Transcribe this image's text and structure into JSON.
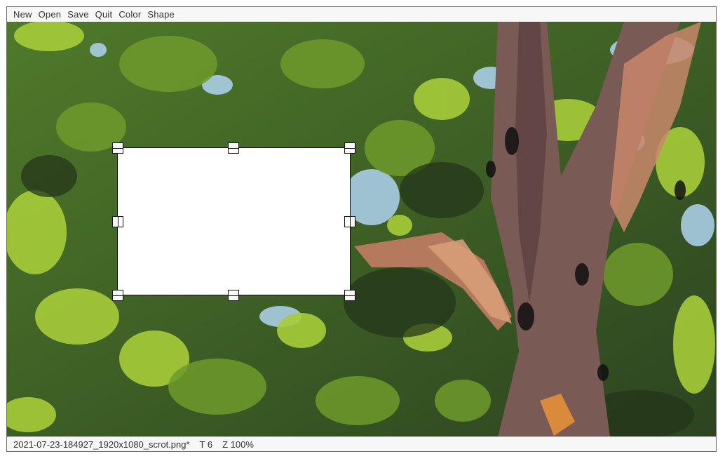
{
  "menubar": {
    "items": [
      "New",
      "Open",
      "Save",
      "Quit",
      "Color",
      "Shape"
    ]
  },
  "statusbar": {
    "filename": "2021-07-23-184927_1920x1080_scrot.png*",
    "tool": "T 6",
    "zoom": "Z 100%"
  },
  "canvas": {
    "image_description_colors": {
      "sky": "#a9cde4",
      "leaf_light": "#a6cc3a",
      "leaf_mid": "#6f9a2c",
      "leaf_dark": "#2f4a22",
      "bark": "#7a5a55",
      "bark_highlight": "#c9876b"
    }
  }
}
